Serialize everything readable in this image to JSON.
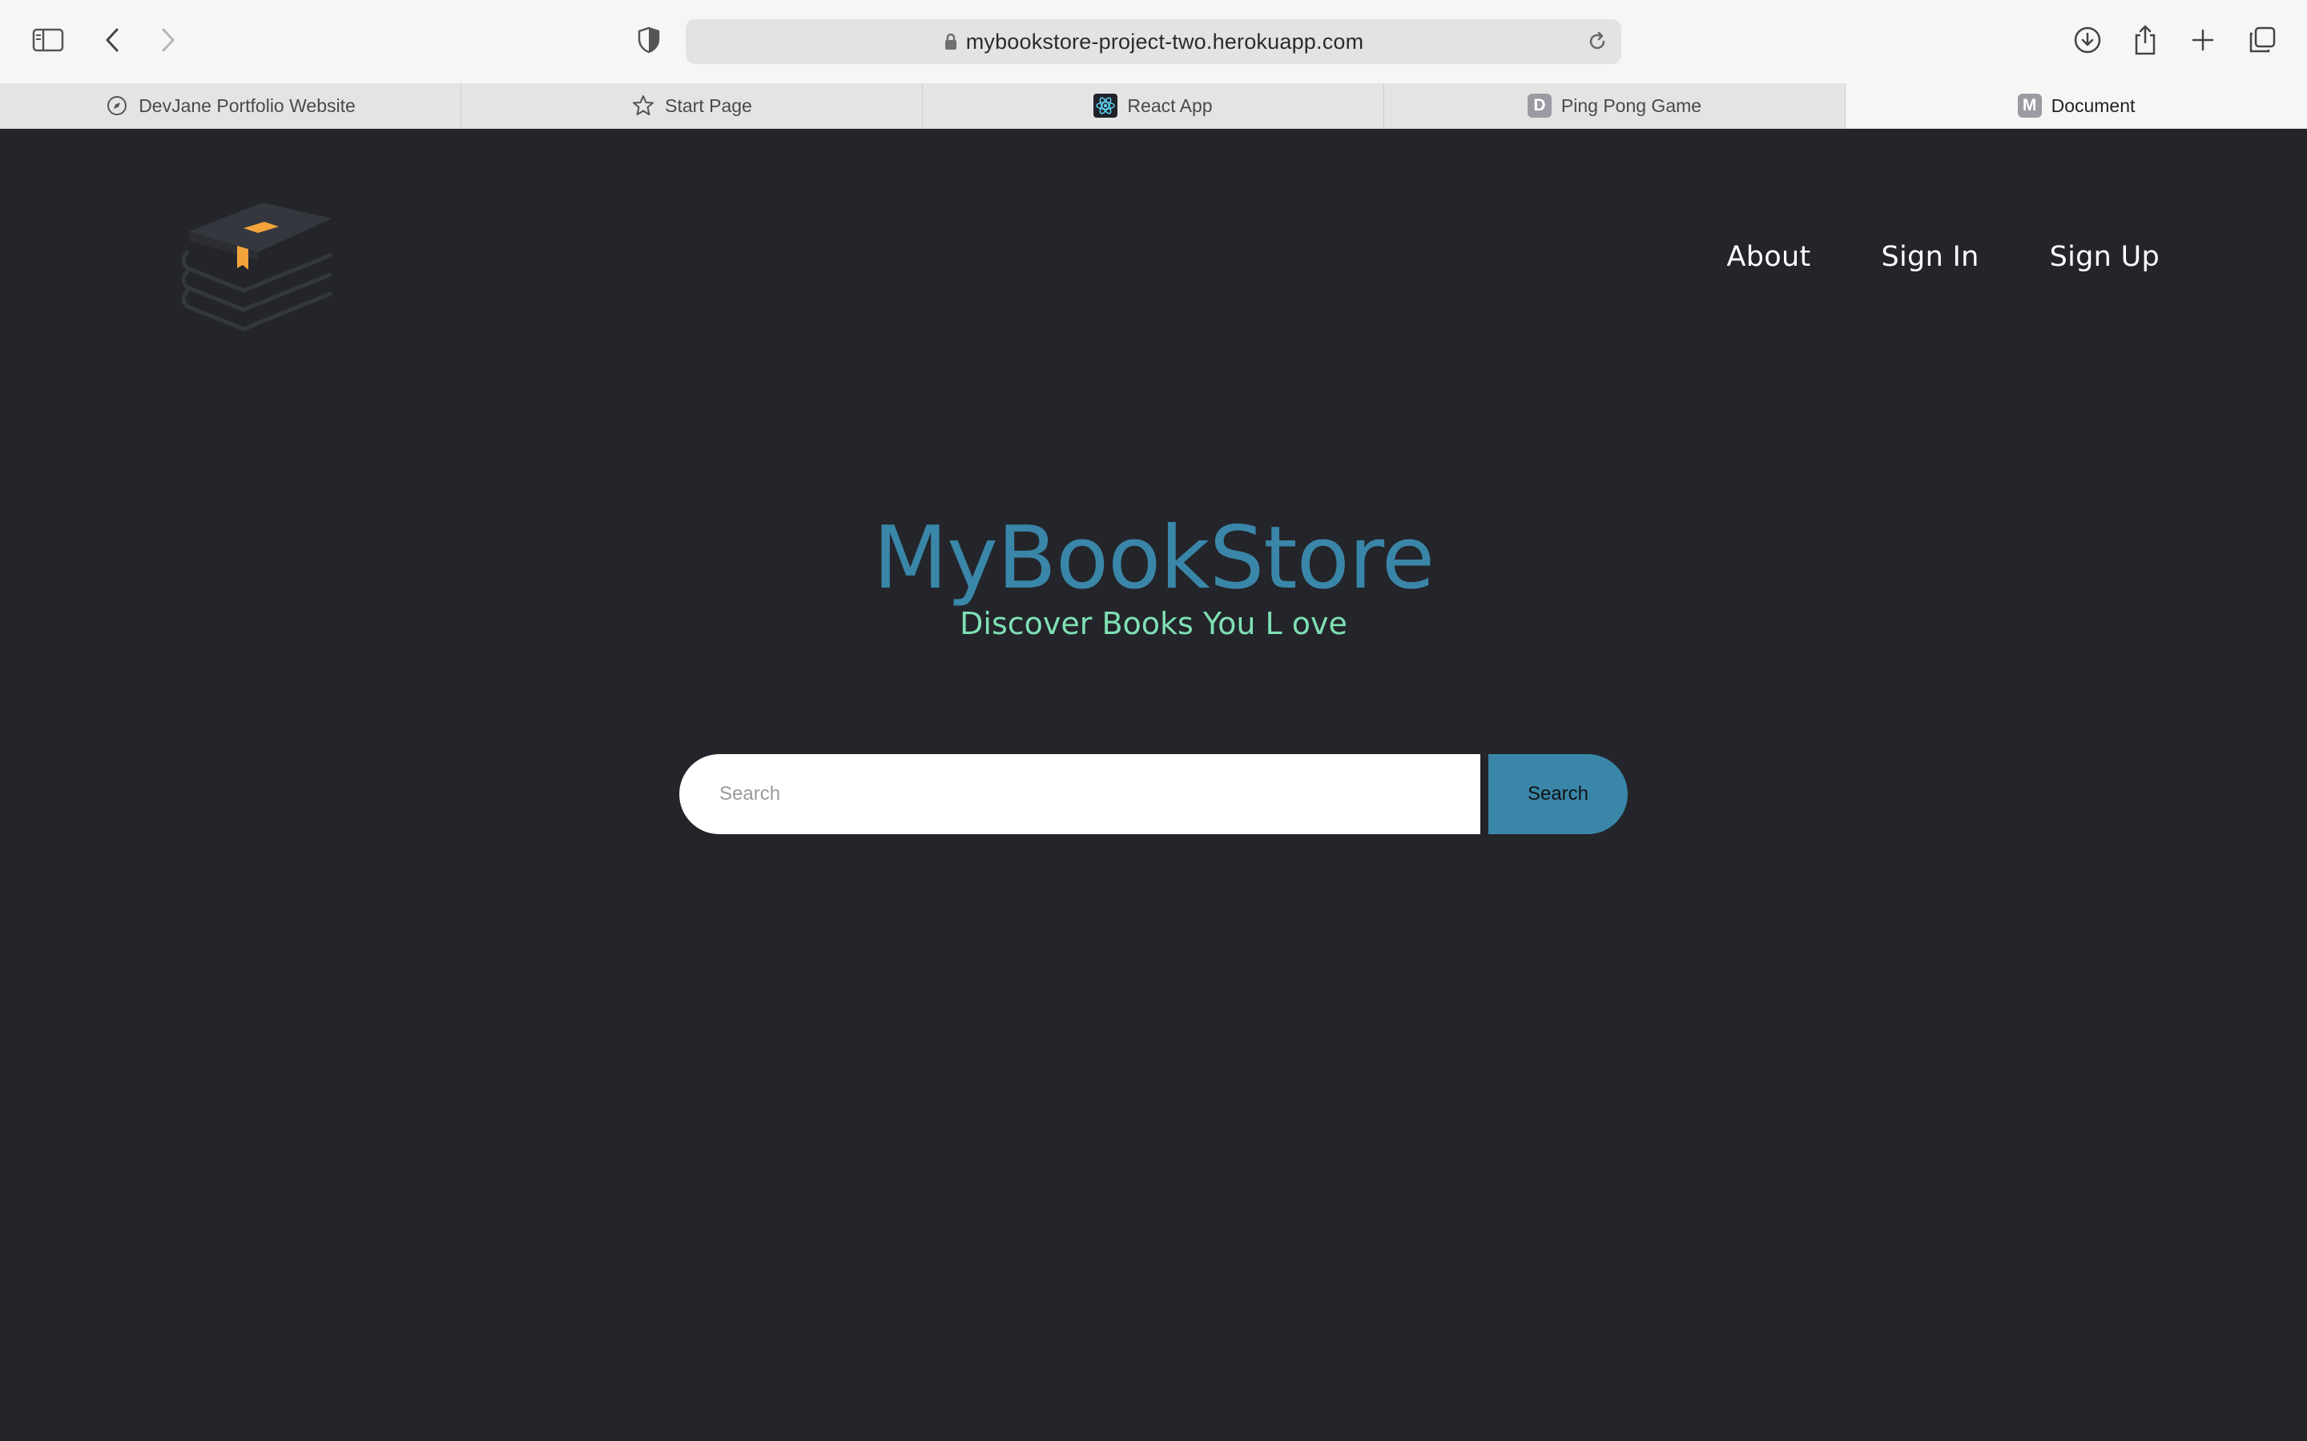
{
  "browser": {
    "url": "mybookstore-project-two.herokuapp.com",
    "tabs": [
      {
        "label": "DevJane Portfolio Website",
        "icon": "compass-icon"
      },
      {
        "label": "Start Page",
        "icon": "star-icon"
      },
      {
        "label": "React App",
        "icon": "react-icon"
      },
      {
        "label": "Ping Pong Game",
        "icon": "letter-d-icon",
        "letter": "D"
      },
      {
        "label": "Document",
        "icon": "letter-m-icon",
        "letter": "M",
        "active": true
      }
    ]
  },
  "nav": {
    "about": "About",
    "sign_in": "Sign In",
    "sign_up": "Sign Up"
  },
  "hero": {
    "title": "MyBookStore",
    "subtitle": "Discover Books You L ove"
  },
  "search": {
    "placeholder": "Search",
    "button": "Search"
  },
  "colors": {
    "page_bg": "#23252a",
    "accent": "#3a86a8",
    "subtitle": "#7fe0b4",
    "logo_bookmark": "#f2a33a"
  }
}
